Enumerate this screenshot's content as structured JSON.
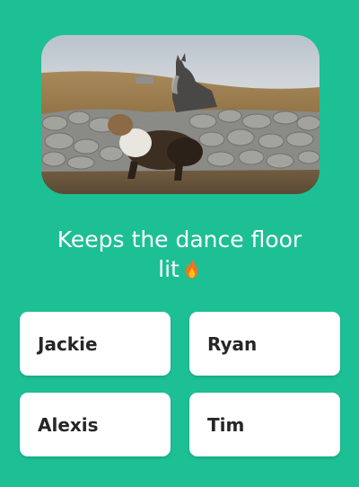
{
  "question": {
    "line1": "Keeps the dance floor",
    "line2": "lit",
    "emoji_icon": "fire-icon"
  },
  "media": {
    "icon": "photo-horses-stone-wall"
  },
  "options": [
    {
      "label": "Jackie"
    },
    {
      "label": "Ryan"
    },
    {
      "label": "Alexis"
    },
    {
      "label": "Tim"
    }
  ],
  "colors": {
    "background": "#1DBF95",
    "card": "#FFFFFF",
    "text": "#262626"
  }
}
